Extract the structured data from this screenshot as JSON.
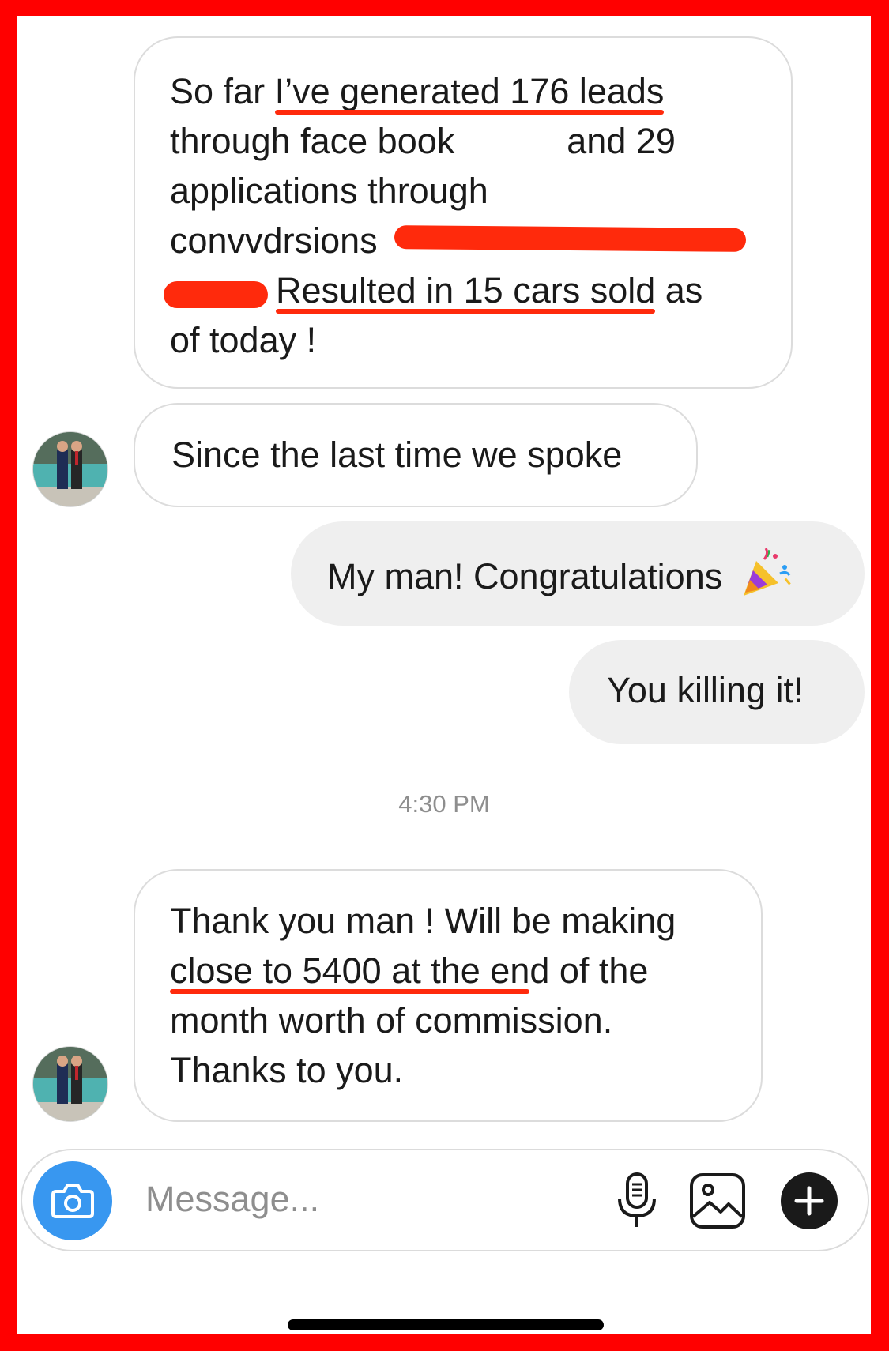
{
  "conversation": {
    "messages": [
      {
        "sender": "other",
        "lines": [
          [
            "So far ",
            "I’ve generated 176 leads",
            ""
          ],
          [
            "through face book",
            "",
            "and 29"
          ],
          [
            "applications through",
            "",
            ""
          ],
          [
            "convvdrsions",
            "",
            ""
          ],
          [
            "",
            "Resulted in 15 cars sold",
            " as"
          ],
          [
            "of today !",
            "",
            ""
          ]
        ]
      },
      {
        "sender": "other",
        "text": "Since the last time we spoke"
      },
      {
        "sender": "me",
        "text": "My man! Congratulations",
        "emoji": "party-popper"
      },
      {
        "sender": "me",
        "text": "You killing it!"
      }
    ],
    "timestamp": "4:30 PM",
    "last_message": {
      "sender": "other",
      "line1": "Thank you man ! Will be making",
      "line2_underlined": "close to 5400 at the en",
      "line2_rest": "d of the",
      "line3": "month worth of commission.",
      "line4": "Thanks to you."
    }
  },
  "composer": {
    "placeholder": "Message...",
    "icons": [
      "camera-icon",
      "microphone-icon",
      "gallery-icon",
      "plus-icon"
    ]
  },
  "colors": {
    "frame": "#ff0000",
    "annotation": "#ff2a0c",
    "outgoing_bubble": "#efefef",
    "camera_button": "#3897f0"
  }
}
